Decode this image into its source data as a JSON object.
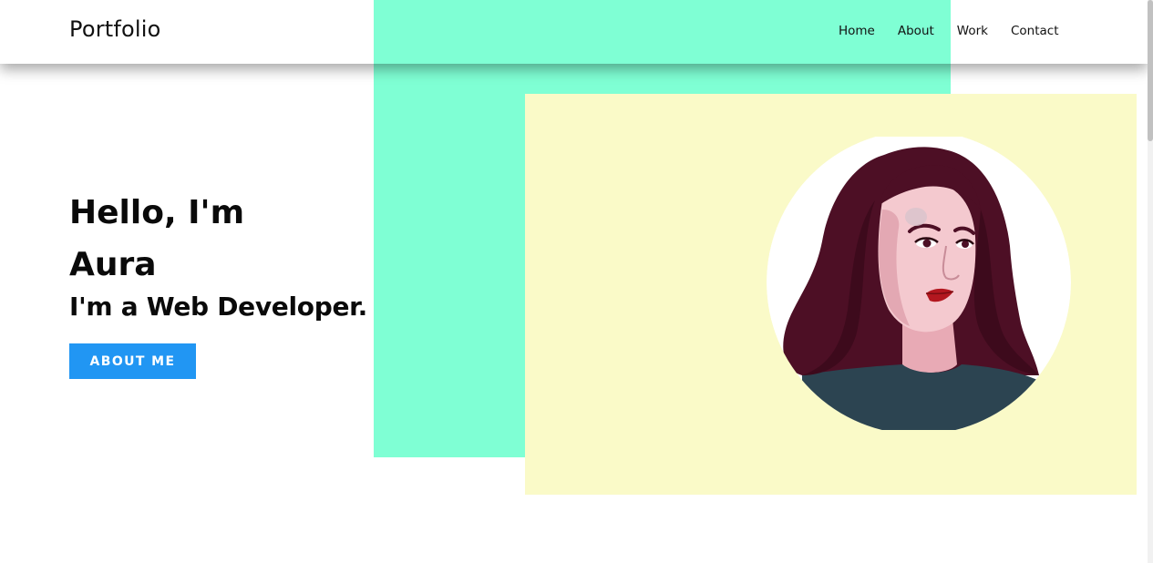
{
  "nav": {
    "logo": "Portfolio",
    "links": [
      "Home",
      "About",
      "Work",
      "Contact"
    ]
  },
  "hero": {
    "greeting": "Hello, I'm",
    "name": "Aura",
    "role": "I'm a Web Developer.",
    "cta_label": "ABOUT ME"
  },
  "colors": {
    "mint": "#7fffd4",
    "cream": "#fafac8",
    "cta": "#2196f3",
    "hair": "#4d0f25",
    "skin": "#f4c9cf",
    "shirt": "#2c4451"
  },
  "icons": {
    "portrait": "avatar-illustration"
  }
}
